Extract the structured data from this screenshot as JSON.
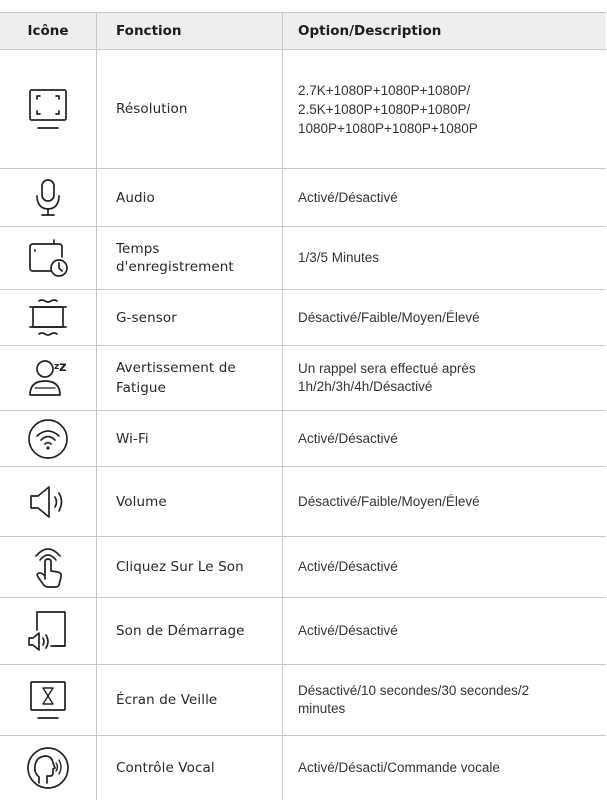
{
  "header": {
    "icon_col": "Icône",
    "function_col": "Fonction",
    "option_col": "Option/Description"
  },
  "rows": [
    {
      "icon": "screen-resolution-icon",
      "function": "Résolution",
      "description": "2.7K+1080P+1080P+1080P/\n2.5K+1080P+1080P+1080P/\n1080P+1080P+1080P+1080P"
    },
    {
      "icon": "microphone-icon",
      "function": "Audio",
      "description": "Activé/Désactivé"
    },
    {
      "icon": "recording-timer-icon",
      "function": "Temps\nd'enregistrement",
      "description": "1/3/5 Minutes"
    },
    {
      "icon": "g-sensor-icon",
      "function": "G-sensor",
      "description": "Désactivé/Faible/Moyen/Élevé"
    },
    {
      "icon": "fatigue-warning-icon",
      "function": "Avertissement de\nFatigue",
      "description": "Un rappel sera effectué après\n1h/2h/3h/4h/Désactivé"
    },
    {
      "icon": "wifi-icon",
      "function": "Wi-Fi",
      "description": "Activé/Désactivé"
    },
    {
      "icon": "volume-icon",
      "function": "Volume",
      "description": "Désactivé/Faible/Moyen/Élevé"
    },
    {
      "icon": "touch-sound-icon",
      "function": "Cliquez Sur Le Son",
      "description": "Activé/Désactivé"
    },
    {
      "icon": "startup-sound-icon",
      "function": "Son de Démarrage",
      "description": "Activé/Désactivé"
    },
    {
      "icon": "screensaver-icon",
      "function": "Écran de Veille",
      "description": "Désactivé/10 secondes/30 secondes/2\nminutes"
    },
    {
      "icon": "voice-control-icon",
      "function": "Contrôle Vocal",
      "description": "Activé/Désacti/Commande vocale"
    }
  ],
  "icon_glyphs": {
    "fatigue_zz": "z",
    "fatigue_small_z": "z",
    "screensaver_hourglass": "⌛"
  }
}
